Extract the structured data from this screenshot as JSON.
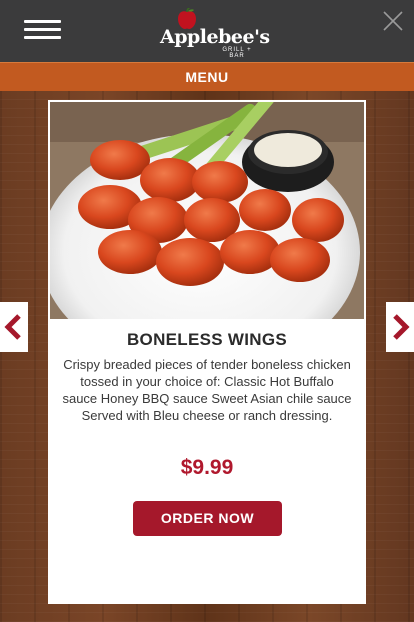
{
  "header": {
    "brand": "Applebee's",
    "subbrand": "GRILL + BAR",
    "menu_label": "MENU",
    "icons": {
      "menu": "hamburger-menu-icon",
      "close": "close-icon",
      "logo": "apple-logo-icon"
    }
  },
  "item": {
    "name": "BONELESS WINGS",
    "description": "Crispy breaded pieces of tender boneless chicken tossed in your choice of: Classic Hot Buffalo sauce Honey BBQ sauce Sweet Asian chile sauce Served with Bleu cheese or ranch dressing.",
    "price": "$9.99",
    "order_label": "ORDER NOW"
  },
  "navigation": {
    "prev_icon": "chevron-left-icon",
    "next_icon": "chevron-right-icon"
  },
  "colors": {
    "topbar": "#3b3b3c",
    "menubar": "#c25a20",
    "accent": "#a5182b",
    "price": "#b0182d"
  }
}
